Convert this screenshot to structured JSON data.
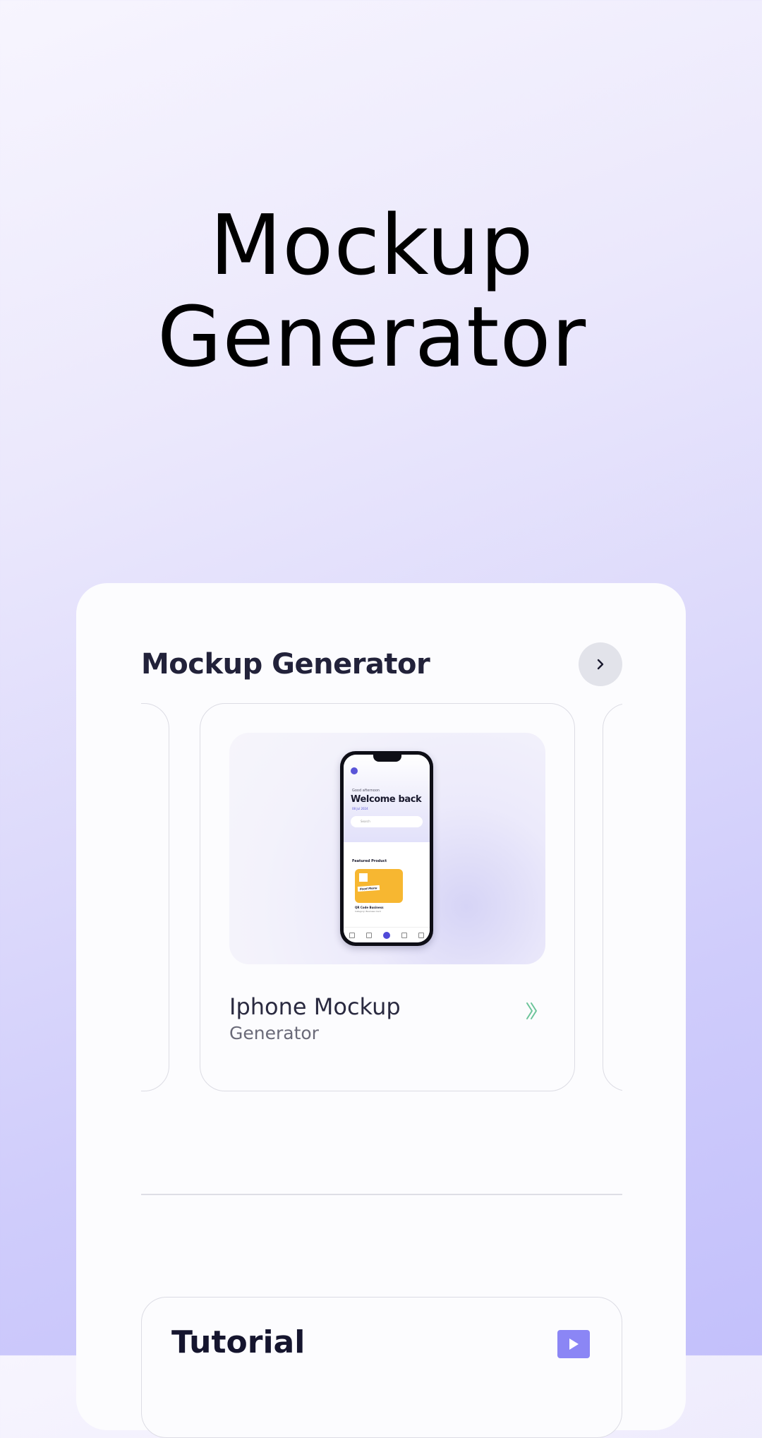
{
  "hero": {
    "title_line1": "Mockup",
    "title_line2": "Generator"
  },
  "section": {
    "title": "Mockup Generator",
    "next_icon": "chevron-right-icon"
  },
  "card": {
    "title": "Iphone Mockup",
    "subtitle": "Generator",
    "arrow_icon": "double-chevron-right-icon",
    "arrow_color": "#6cc49a"
  },
  "phone_preview": {
    "greeting": "Good afternoon",
    "welcome": "Welcome back",
    "date": "08 Jul 2024",
    "search_placeholder": "Search",
    "featured": "Featured Product",
    "product_label": "Food Menu",
    "product_name": "QR Code Business",
    "product_category": "Category: Business Card"
  },
  "tutorial": {
    "title": "Tutorial",
    "play_icon": "play-icon",
    "play_color": "#8b86f5"
  }
}
